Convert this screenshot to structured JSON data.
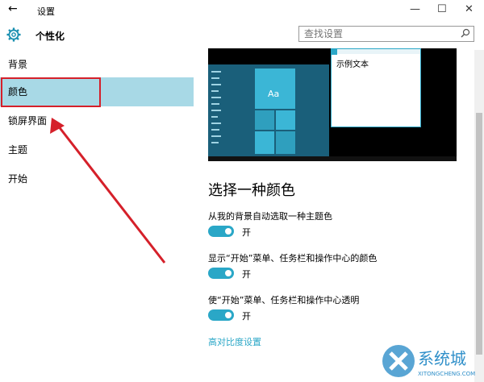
{
  "titlebar": {
    "back_icon": "back-arrow-icon",
    "title": "设置",
    "minimize": "—",
    "maximize": "☐",
    "close": "✕"
  },
  "header": {
    "icon": "gear-icon",
    "name": "个性化",
    "search_placeholder": "查找设置"
  },
  "sidebar": {
    "items": [
      {
        "label": "背景",
        "selected": false
      },
      {
        "label": "颜色",
        "selected": true
      },
      {
        "label": "锁屏界面",
        "selected": false
      },
      {
        "label": "主题",
        "selected": false
      },
      {
        "label": "开始",
        "selected": false
      }
    ]
  },
  "preview": {
    "tile_text": "Aa",
    "sample_text": "示例文本"
  },
  "main": {
    "heading": "选择一种颜色",
    "options": [
      {
        "label": "从我的背景自动选取一种主题色",
        "state": "开",
        "on": true
      },
      {
        "label": "显示“开始”菜单、任务栏和操作中心的颜色",
        "state": "开",
        "on": true
      },
      {
        "label": "使“开始”菜单、任务栏和操作中心透明",
        "state": "开",
        "on": true
      }
    ],
    "link": "高对比度设置"
  },
  "colors": {
    "accent": "#2aa7c7",
    "selection": "#a8d9e6",
    "annotation": "#d5202a"
  },
  "watermark": {
    "text": "系统城",
    "subtext": "XITONGCHENG.COM"
  }
}
